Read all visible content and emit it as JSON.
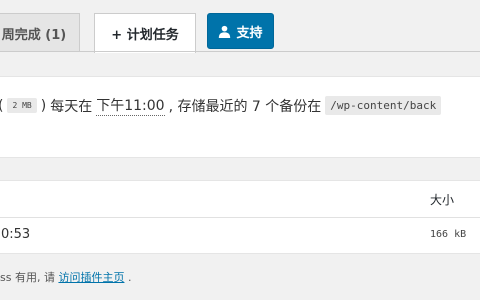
{
  "tabs": {
    "done_label": "周完成 (1)",
    "schedule_label": "+ 计划任务",
    "support_label": "支持"
  },
  "schedule": {
    "paren_open": "(",
    "size": "2 MB",
    "paren_close": ")",
    "text_every": "每天在",
    "time": "下午11:00",
    "text_keep": ", 存储最近的 7 个备份在",
    "path": "/wp-content/back"
  },
  "table": {
    "header_size": "大小",
    "rows": [
      {
        "time": "0:53",
        "size": "166 kB"
      }
    ]
  },
  "footer": {
    "text": "ss 有用, 请",
    "link": "访问插件主页",
    "suffix": "."
  },
  "colors": {
    "accent": "#0073aa",
    "background": "#f1f1f1"
  },
  "icons": {
    "support": "user-icon"
  }
}
